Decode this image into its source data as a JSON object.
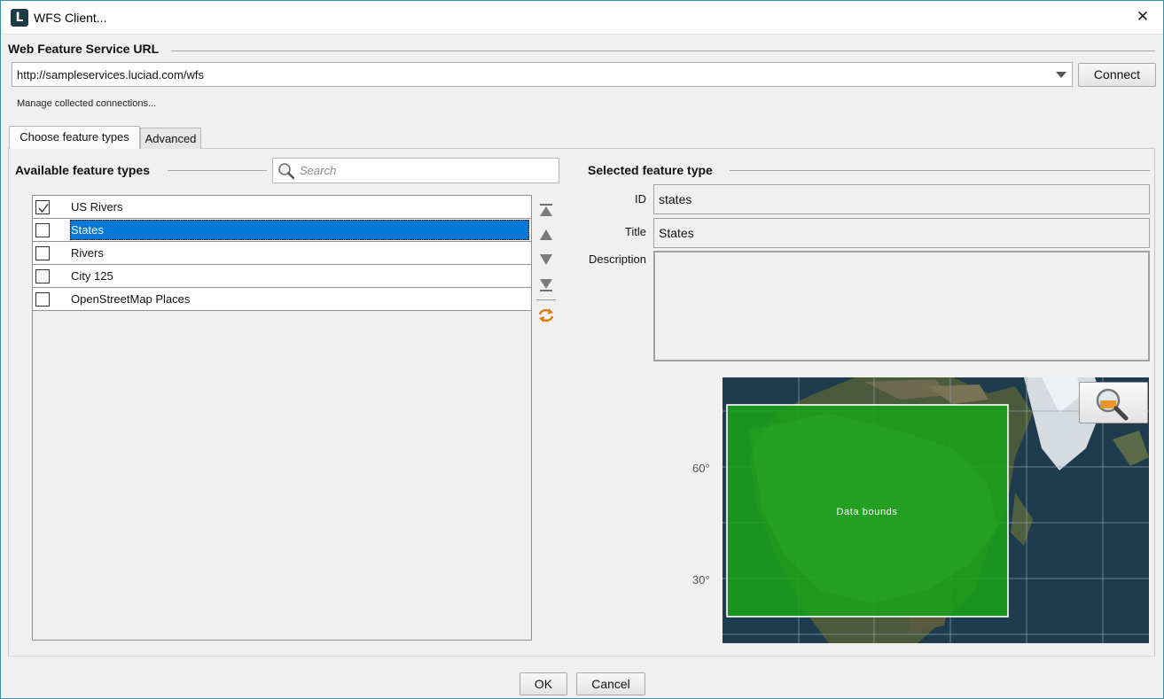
{
  "window": {
    "title": "WFS Client...",
    "close_glyph": "✕"
  },
  "url_section": {
    "title": "Web Feature Service URL",
    "url_value": "http://sampleservices.luciad.com/wfs",
    "connect_label": "Connect",
    "manage_label": "Manage collected connections..."
  },
  "tabs": [
    {
      "label": "Choose feature types",
      "active": true
    },
    {
      "label": "Advanced",
      "active": false
    }
  ],
  "available": {
    "title": "Available feature types",
    "search_placeholder": "Search",
    "items": [
      {
        "label": "US Rivers",
        "checked": true,
        "selected": false
      },
      {
        "label": "States",
        "checked": false,
        "selected": true
      },
      {
        "label": "Rivers",
        "checked": false,
        "selected": false
      },
      {
        "label": "City 125",
        "checked": false,
        "selected": false
      },
      {
        "label": "OpenStreetMap Places",
        "checked": false,
        "selected": false
      }
    ],
    "side_buttons": [
      "move-top-icon",
      "move-up-icon",
      "move-down-icon",
      "move-bottom-icon",
      "refresh-icon"
    ]
  },
  "selected": {
    "title": "Selected feature type",
    "id_label": "ID",
    "id_value": "states",
    "title_label": "Title",
    "title_value": "States",
    "description_label": "Description",
    "description_value": ""
  },
  "map": {
    "bounds_label": "Data bounds",
    "lat_labels": [
      "60°",
      "30°"
    ],
    "bounds_color": "#1aa01a"
  },
  "footer": {
    "ok_label": "OK",
    "cancel_label": "Cancel"
  },
  "colors": {
    "selection": "#0078d7",
    "window_border": "#3c8fa5",
    "accent_icon": "#e07a10"
  }
}
